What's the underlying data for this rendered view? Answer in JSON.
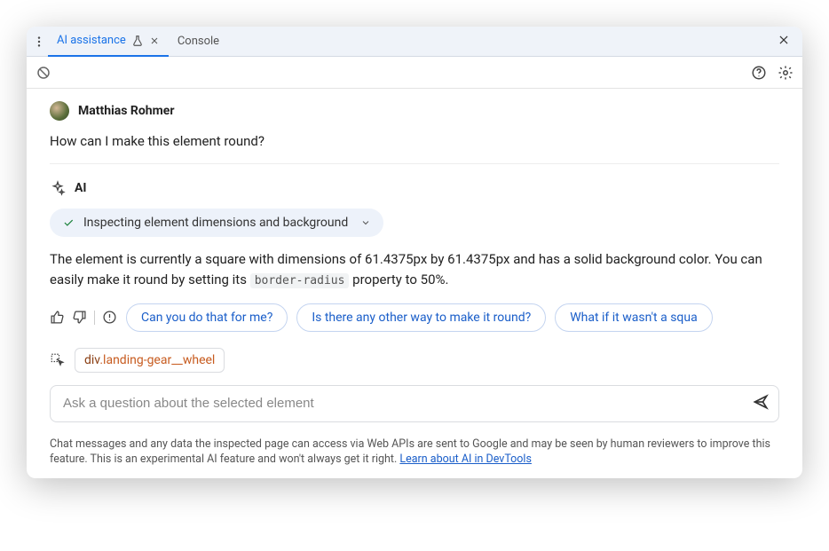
{
  "tabs": {
    "active": "AI assistance",
    "inactive": "Console"
  },
  "user": {
    "name": "Matthias Rohmer",
    "question": "How can I make this element round?"
  },
  "ai": {
    "label": "AI",
    "status": "Inspecting element dimensions and background",
    "response_pre": "The element is currently a square with dimensions of 61.4375px by 61.4375px and has a solid background color. You can easily make it round by setting its ",
    "response_code": "border-radius",
    "response_post": " property to 50%."
  },
  "suggestions": {
    "s1": "Can you do that for me?",
    "s2": "Is there any other way to make it round?",
    "s3": "What if it wasn't a squa"
  },
  "selector": {
    "element": "div",
    "cls": ".landing-gear__wheel"
  },
  "input": {
    "placeholder": "Ask a question about the selected element"
  },
  "disclaimer": {
    "text": "Chat messages and any data the inspected page can access via Web APIs are sent to Google and may be seen by human reviewers to improve this feature. This is an experimental AI feature and won't always get it right. ",
    "link": "Learn about AI in DevTools"
  }
}
